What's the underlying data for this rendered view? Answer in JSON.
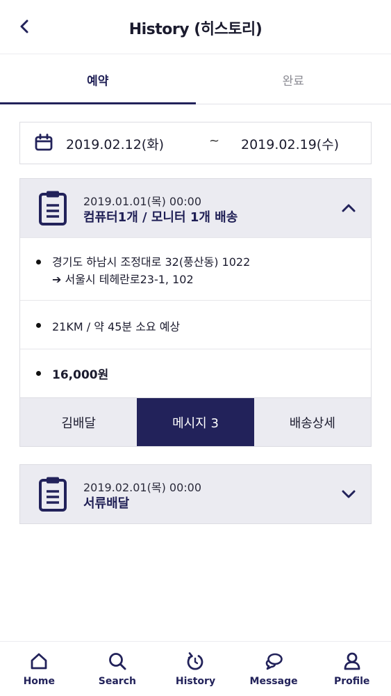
{
  "header": {
    "title": "History (히스토리)"
  },
  "tabs": [
    {
      "label": "예약",
      "active": true
    },
    {
      "label": "완료",
      "active": false
    }
  ],
  "date_range": {
    "start": "2019.02.12(화)",
    "separator": "~",
    "end": "2019.02.19(수)"
  },
  "orders": [
    {
      "datetime": "2019.01.01(목) 00:00",
      "title": "컴퓨터1개 / 모니터 1개 배송",
      "expanded": true,
      "route_from": "경기도 하남시 조정대로 32(풍산동) 1022",
      "route_to": "➔ 서울시 테헤란로23-1, 102",
      "distance": "21KM / 약 45분 소요 예상",
      "price": "16,000원",
      "actions": {
        "driver": "김배달",
        "message": "메시지 3",
        "detail": "배송상세"
      }
    },
    {
      "datetime": "2019.02.01(목) 00:00",
      "title": "서류배달",
      "expanded": false
    }
  ],
  "nav": {
    "home": "Home",
    "search": "Search",
    "history": "History",
    "message": "Message",
    "profile": "Profile"
  },
  "colors": {
    "accent": "#22225a",
    "card_header_bg": "#ebebf1"
  }
}
